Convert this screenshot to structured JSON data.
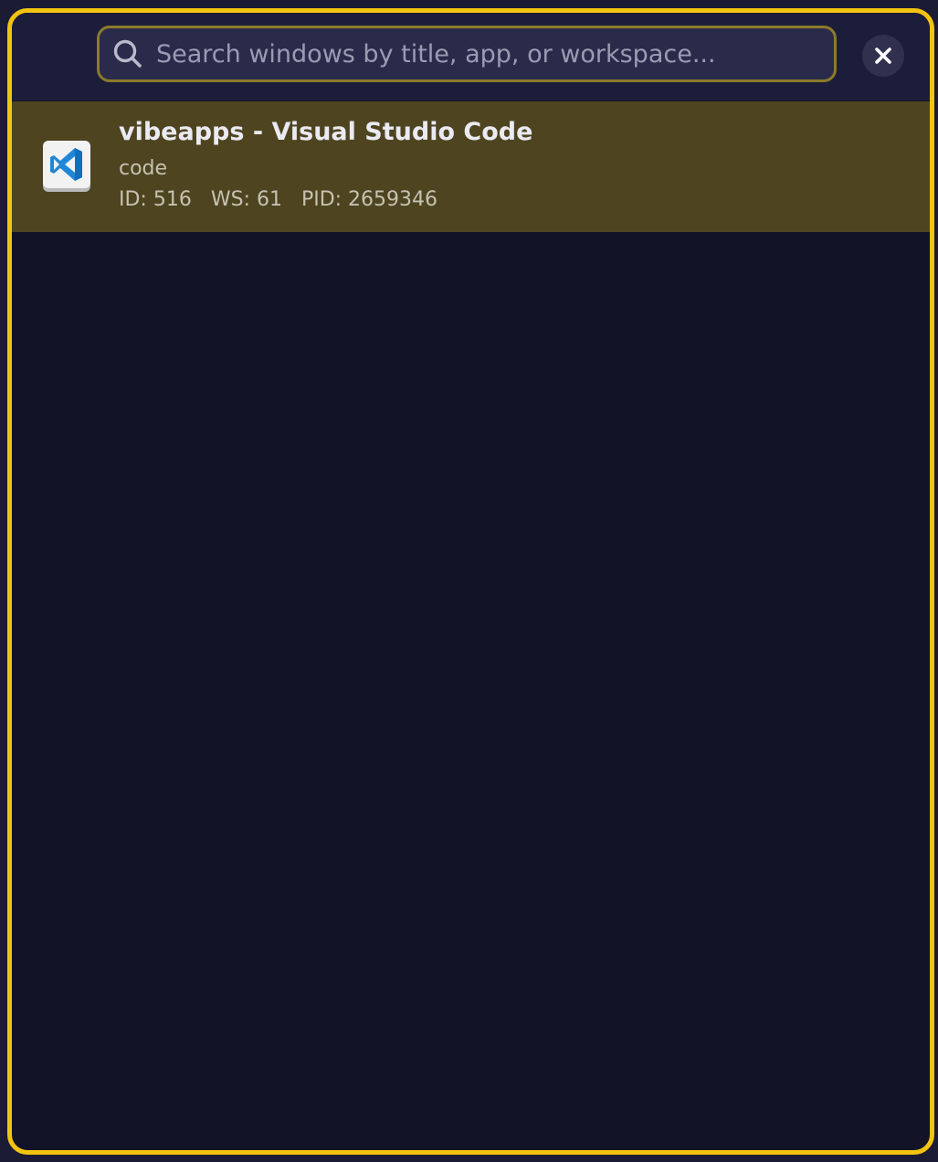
{
  "search": {
    "placeholder": "Search windows by title, app, or workspace...",
    "value": "",
    "icon": "search-icon"
  },
  "close_button": {
    "icon": "close-icon"
  },
  "results": [
    {
      "title": "vibeapps - Visual Studio Code",
      "app_class": "code",
      "id_text": "ID: 516",
      "ws_text": "WS: 61",
      "pid_text": "PID: 2659346",
      "icon": "vscode-icon"
    }
  ],
  "colors": {
    "frame_border": "#f2c40f",
    "selected_row": "#4e4420",
    "background": "#121327",
    "header": "#1c1d3a"
  }
}
